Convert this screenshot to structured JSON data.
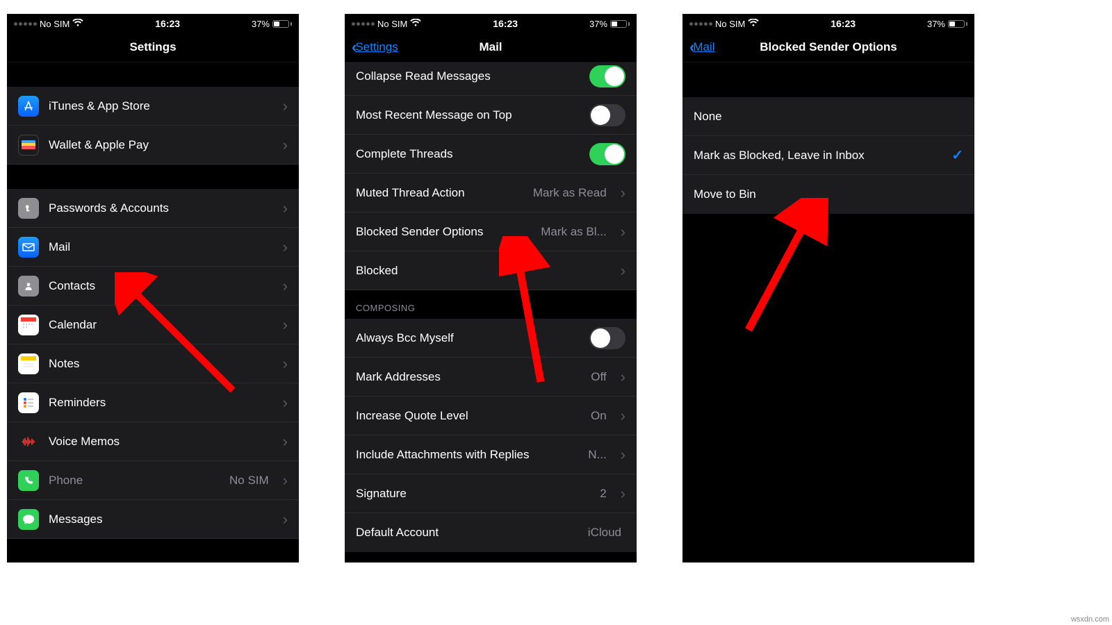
{
  "status": {
    "carrier": "No SIM",
    "time": "16:23",
    "battery": "37%"
  },
  "watermark": "wsxdn.com",
  "phone1": {
    "title": "Settings",
    "rows": {
      "itunes": "iTunes & App Store",
      "wallet": "Wallet & Apple Pay",
      "passwords": "Passwords & Accounts",
      "mail": "Mail",
      "contacts": "Contacts",
      "calendar": "Calendar",
      "notes": "Notes",
      "reminders": "Reminders",
      "voicememos": "Voice Memos",
      "phone": "Phone",
      "phone_value": "No SIM",
      "messages": "Messages"
    }
  },
  "phone2": {
    "back": "Settings",
    "title": "Mail",
    "rows": {
      "collapse": "Collapse Read Messages",
      "recenttop": "Most Recent Message on Top",
      "complete": "Complete Threads",
      "mutedaction": "Muted Thread Action",
      "mutedaction_value": "Mark as Read",
      "blockedopts": "Blocked Sender Options",
      "blockedopts_value": "Mark as Bl...",
      "blocked": "Blocked",
      "section_composing": "COMPOSING",
      "alwaysbcc": "Always Bcc Myself",
      "markaddr": "Mark Addresses",
      "markaddr_value": "Off",
      "incquote": "Increase Quote Level",
      "incquote_value": "On",
      "includeattach": "Include Attachments with Replies",
      "includeattach_value": "N...",
      "signature": "Signature",
      "signature_value": "2",
      "defaultacct": "Default Account",
      "defaultacct_value": "iCloud"
    }
  },
  "phone3": {
    "back": "Mail",
    "title": "Blocked Sender Options",
    "rows": {
      "none": "None",
      "markleave": "Mark as Blocked, Leave in Inbox",
      "movebin": "Move to Bin"
    }
  }
}
